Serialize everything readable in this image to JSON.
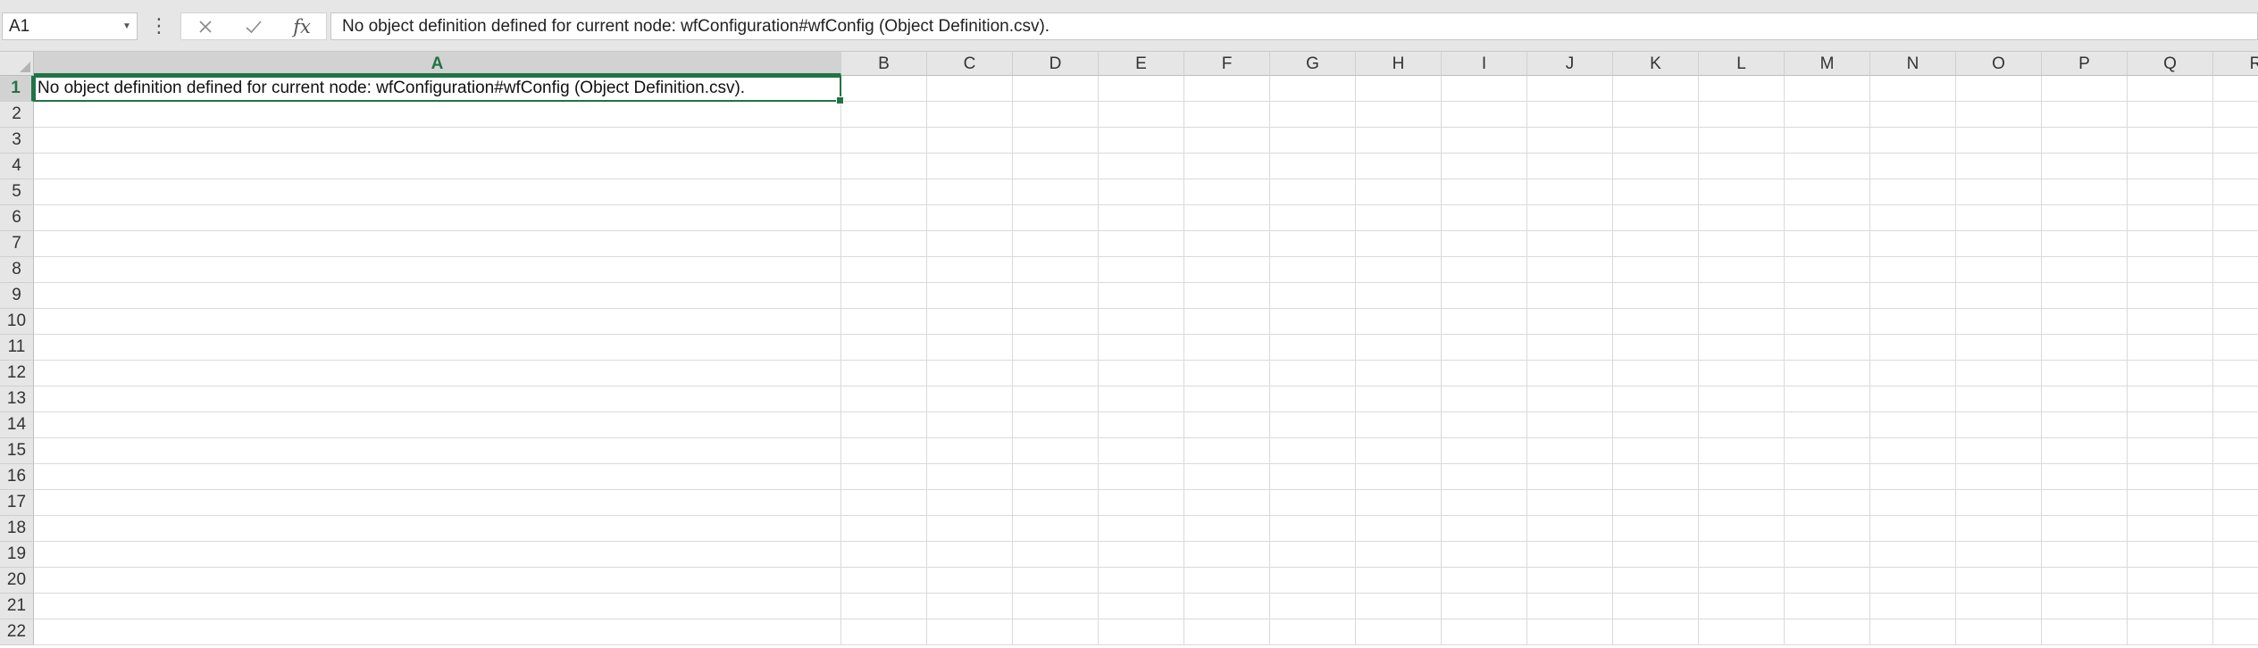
{
  "formula_bar": {
    "name_box": "A1",
    "formula": "No object definition defined for current node: wfConfiguration#wfConfig (Object Definition.csv).",
    "fx_label": "fx",
    "cancel_icon": "close-icon",
    "enter_icon": "check-icon"
  },
  "grid": {
    "columns": [
      "A",
      "B",
      "C",
      "D",
      "E",
      "F",
      "G",
      "H",
      "I",
      "J",
      "K",
      "L",
      "M",
      "N",
      "O",
      "P",
      "Q",
      "R"
    ],
    "rows": [
      "1",
      "2",
      "3",
      "4",
      "5",
      "6",
      "7",
      "8",
      "9",
      "10",
      "11",
      "12",
      "13",
      "14",
      "15",
      "16",
      "17",
      "18",
      "19",
      "20",
      "21",
      "22"
    ],
    "active_column": "A",
    "active_row": "1",
    "cell_A1": "No object definition defined for current node: wfConfiguration#wfConfig (Object Definition.csv)."
  },
  "colors": {
    "accent": "#217346",
    "header_bg": "#e6e6e6",
    "gridline": "#dadada"
  }
}
